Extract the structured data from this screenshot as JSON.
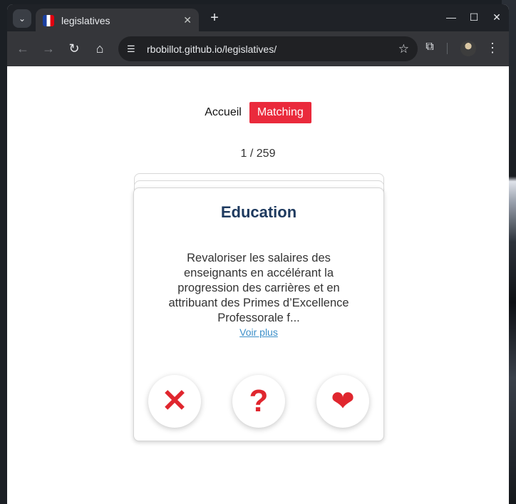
{
  "browser": {
    "tab_title": "legislatives",
    "tab_close": "✕",
    "new_tab": "+",
    "url": "rbobillot.github.io/legislatives/",
    "controls": {
      "minimize": "—",
      "maximize": "☐",
      "close": "✕"
    },
    "icons": {
      "tab_search": "chevron-down-icon",
      "back": "back-arrow-icon",
      "forward": "forward-arrow-icon",
      "reload": "reload-icon",
      "home": "home-icon",
      "site_info": "tune-icon",
      "bookmark": "star-icon",
      "extensions": "puzzle-icon",
      "menu": "more-vert-icon"
    }
  },
  "nav": {
    "home_label": "Accueil",
    "matching_label": "Matching"
  },
  "counter": "1 / 259",
  "card": {
    "title": "Education",
    "text": "Revaloriser les salaires des enseignants en accélérant la progression des carrières et en attribuant des Primes d’Excellence Professorale f...",
    "see_more": "Voir plus"
  },
  "actions": {
    "no": "✕",
    "maybe": "?",
    "yes": "❤"
  },
  "colors": {
    "accent": "#ea2a3c",
    "title": "#1e3a5f",
    "link": "#3b8fc9",
    "icon_red": "#e0262e"
  }
}
